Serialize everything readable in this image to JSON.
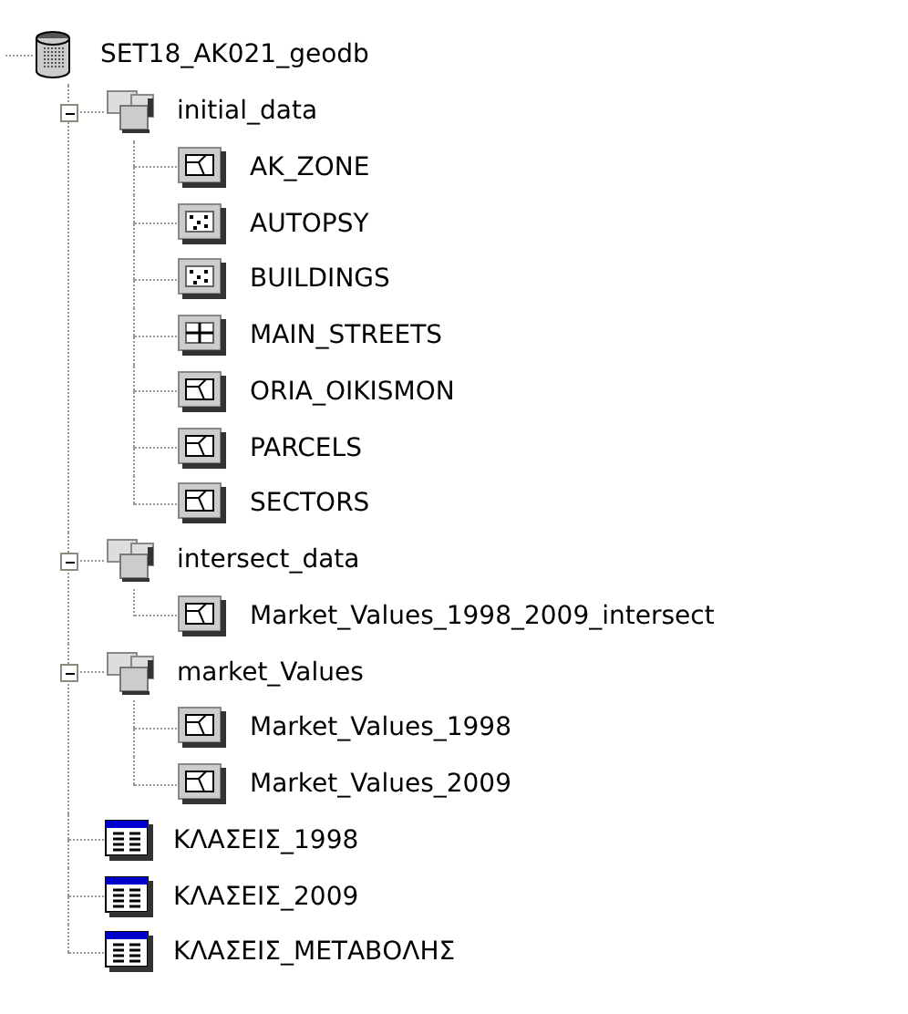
{
  "tree": {
    "label": "SET18_AK021_geodb",
    "kind": "database",
    "children": [
      {
        "label": "initial_data",
        "kind": "dataset",
        "expanded": true,
        "children": [
          {
            "label": "AK_ZONE",
            "kind": "polygon"
          },
          {
            "label": "AUTOPSY",
            "kind": "point"
          },
          {
            "label": "BUILDINGS",
            "kind": "point"
          },
          {
            "label": "MAIN_STREETS",
            "kind": "line"
          },
          {
            "label": "ORIA_OIKISMON",
            "kind": "polygon"
          },
          {
            "label": "PARCELS",
            "kind": "polygon"
          },
          {
            "label": "SECTORS",
            "kind": "polygon"
          }
        ]
      },
      {
        "label": "intersect_data",
        "kind": "dataset",
        "expanded": true,
        "children": [
          {
            "label": "Market_Values_1998_2009_intersect",
            "kind": "polygon"
          }
        ]
      },
      {
        "label": "market_Values",
        "kind": "dataset",
        "expanded": true,
        "children": [
          {
            "label": "Market_Values_1998",
            "kind": "polygon"
          },
          {
            "label": "Market_Values_2009",
            "kind": "polygon"
          }
        ]
      },
      {
        "label": "ΚΛΑΣΕΙΣ_1998",
        "kind": "table"
      },
      {
        "label": "ΚΛΑΣΕΙΣ_2009",
        "kind": "table"
      },
      {
        "label": "ΚΛΑΣΕΙΣ_ΜΕΤΑΒΟΛΗΣ",
        "kind": "table"
      }
    ]
  }
}
